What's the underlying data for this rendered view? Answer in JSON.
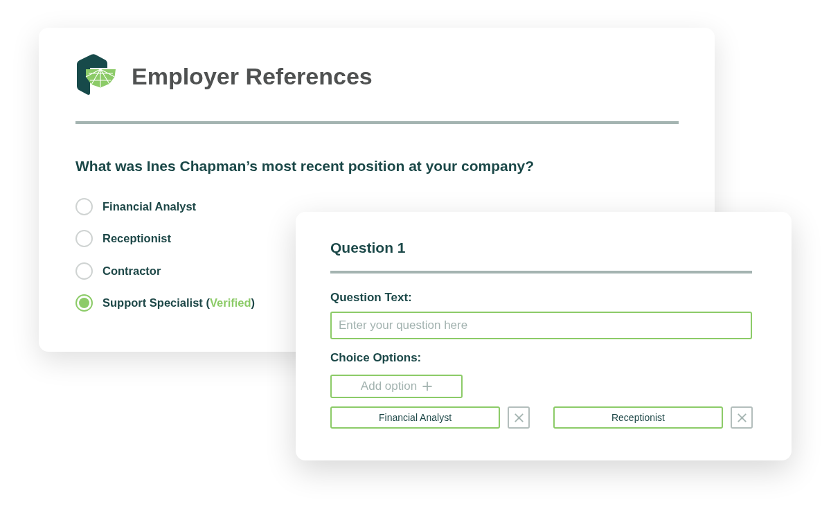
{
  "reference_card": {
    "title": "Employer References",
    "question": {
      "text": "What was Ines Chapman’s most recent position at your company?",
      "options": [
        {
          "label": "Financial Analyst",
          "selected": false
        },
        {
          "label": "Receptionist",
          "selected": false
        },
        {
          "label": "Contractor",
          "selected": false
        },
        {
          "label": "Support Specialist",
          "selected": true,
          "note": {
            "open": "(",
            "text": "Verified",
            "close": ")"
          }
        }
      ]
    }
  },
  "editor_card": {
    "title": "Question 1",
    "question_text": {
      "label": "Question Text:",
      "placeholder": "Enter your question here"
    },
    "choice_options": {
      "label": "Choice Options:",
      "add_button": "Add option",
      "options": [
        {
          "value": "Financial Analyst"
        },
        {
          "value": "Receptionist"
        }
      ]
    }
  }
}
